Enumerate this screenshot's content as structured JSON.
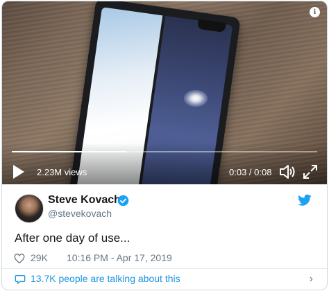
{
  "video": {
    "views": "2.23M views",
    "time": "0:03 / 0:08",
    "progress": 0.375
  },
  "tweet": {
    "author_name": "Steve Kovach",
    "author_handle": "@stevekovach",
    "text": "After one day of use...",
    "likes": "29K",
    "timestamp": "10:16 PM - Apr 17, 2019",
    "talking": "13.7K people are talking about this"
  },
  "colors": {
    "accent": "#1da1f2",
    "link": "#1b95e0",
    "muted": "#657786"
  },
  "icons": [
    "info-icon",
    "play-icon",
    "volume-icon",
    "expand-icon",
    "verified-icon",
    "twitter-icon",
    "heart-icon",
    "comment-icon",
    "chevron-right-icon"
  ]
}
